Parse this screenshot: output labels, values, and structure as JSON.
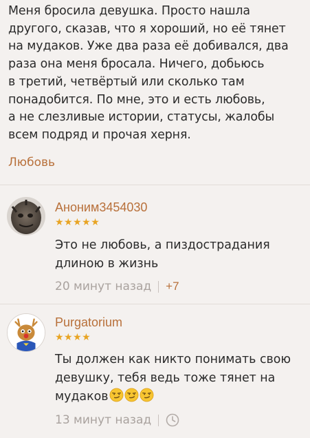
{
  "post": {
    "text": "Меня бросила девушка. Просто нашла\nдругого, сказав, что я хороший, но её тянет\nна мудаков. Уже два раза её добивался, два\nраза она меня бросала. Ничего, добьюсь\nв третий, четвёртый или сколько там\nпонадобится. По мне, это и есть любовь,\nа не слезливые истории, статусы, жалобы\nвсем подряд и прочая херня.",
    "tag": "Любовь"
  },
  "comments": [
    {
      "author": "Аноним3454030",
      "stars": "★★★★★",
      "text": "Это не любовь, а пиздострадания\nдлиною в жизнь",
      "time": "20 минут назад",
      "rating": "+7"
    },
    {
      "author": "Purgatorium",
      "stars": "★★★★",
      "text": "Ты должен как никто понимать свою\nдевушку, тебя ведь тоже тянет на\nмудаков",
      "time": "13 минут назад"
    }
  ],
  "colors": {
    "background": "#f4f1ef",
    "accent": "#b8703a",
    "star": "#e8a423",
    "meta": "#a9a29e"
  },
  "icons": {
    "emoji": "smirking-face",
    "clock": "clock-icon"
  }
}
